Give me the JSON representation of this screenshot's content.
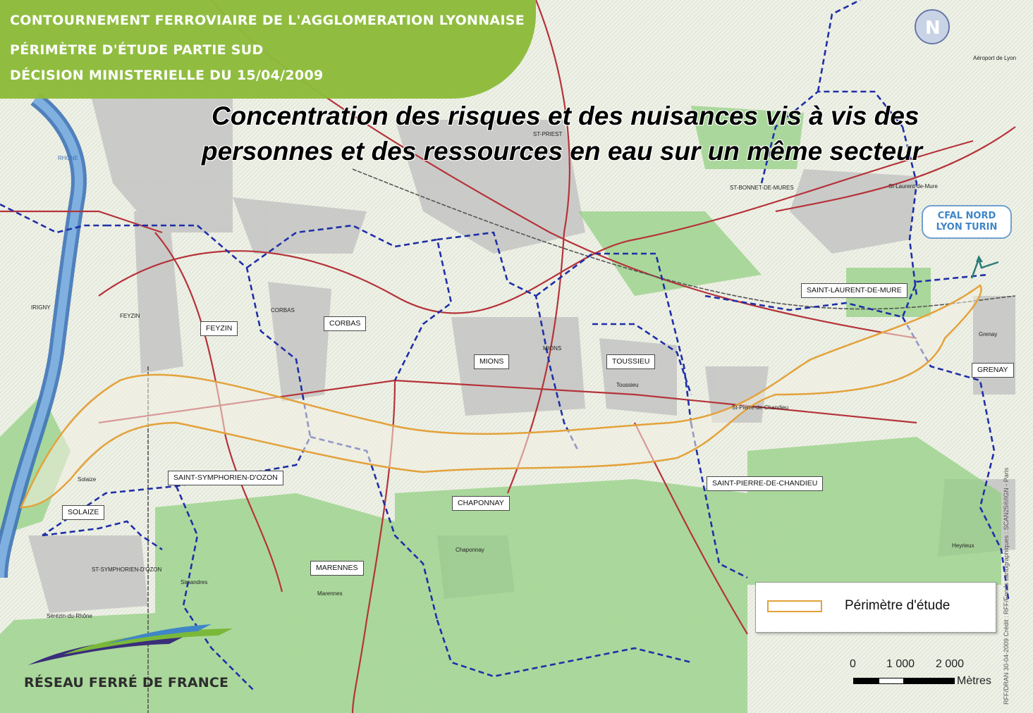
{
  "header": {
    "line1": "CONTOURNEMENT FERROVIAIRE DE L'AGGLOMERATION LYONNAISE",
    "line2": "PÉRIMÈTRE D'ÉTUDE PARTIE SUD",
    "line3": "DÉCISION MINISTERIELLE DU 15/04/2009"
  },
  "headline": {
    "line1": "Concentration des risques et des nuisances vis à vis des",
    "line2": "personnes et des ressources en eau sur un même secteur"
  },
  "communes": [
    "FEYZIN",
    "CORBAS",
    "MIONS",
    "TOUSSIEU",
    "SAINT-LAURENT-DE-MURE",
    "GRENAY",
    "SAINT-SYMPHORIEN-D'OZON",
    "SOLAIZE",
    "CHAPONNAY",
    "SAINT-PIERRE-DE-CHANDIEU",
    "MARENNES"
  ],
  "cfal_badge": {
    "line1": "CFAL NORD",
    "line2": "LYON TURIN"
  },
  "legend": {
    "label": "Périmètre d'étude"
  },
  "scale": {
    "t0": "0",
    "t1": "1 000",
    "t2": "2 000",
    "unit": "Mètres"
  },
  "logo": {
    "text": "RÉSEAU FERRÉ DE FRANCE"
  },
  "credit": "RFF/DRAN 30-04-2009 Crédit : RFF/Fonds cartographiques : SCAN25®/IGN - Paris",
  "map_labels": [
    "ST-PRIEST",
    "ST-BONNET-DE-MURES",
    "St-Laurent-de-Mure",
    "Aéroport de Lyon",
    "Grenay",
    "Heyrieux",
    "Chaponnay",
    "Marennes",
    "Simandres",
    "Sérézin-du-Rhône",
    "ST-SYMPHORIEN-D'OZON",
    "Solaize",
    "CORBAS",
    "MIONS",
    "Toussieu",
    "St-Pierre-de-Chandieu",
    "FEYZIN",
    "IRIGNY",
    "RHÔNE"
  ],
  "colors": {
    "title_panel": "#8dbb3a",
    "perimeter": "#e3a23b",
    "commune_boundary": "#1f2fa8",
    "road": "#b5333a",
    "river": "#3f74b8",
    "cfal": "#3f86c8"
  }
}
